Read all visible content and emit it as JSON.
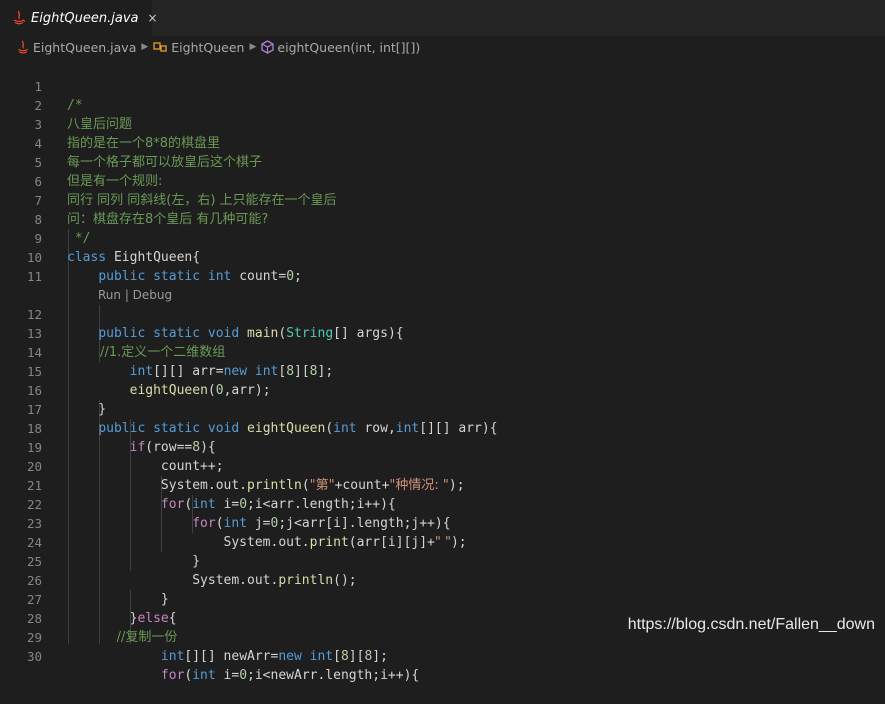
{
  "tab": {
    "title": "EightQueen.java",
    "close": "×"
  },
  "breadcrumb": {
    "file": "EightQueen.java",
    "class": "EightQueen",
    "method": "eightQueen(int, int[][])"
  },
  "codelens": "Run | Debug",
  "lines": [
    {
      "n": "1",
      "text": "/*"
    },
    {
      "n": "2",
      "text": "八皇后问题"
    },
    {
      "n": "3",
      "text": "指的是在一个8*8的棋盘里"
    },
    {
      "n": "4",
      "text": "每一个格子都可以放皇后这个棋子"
    },
    {
      "n": "5",
      "text": "但是有一个规则:"
    },
    {
      "n": "6",
      "text": "同行 同列 同斜线(左，右) 上只能存在一个皇后"
    },
    {
      "n": "7",
      "text": "问：棋盘存在8个皇后 有几种可能?"
    },
    {
      "n": "8",
      "text": " */"
    },
    {
      "n": "9",
      "text": "class EightQueen{"
    },
    {
      "n": "10",
      "text": "    public static int count=0;"
    },
    {
      "n": "11",
      "text": ""
    },
    {
      "n": "12",
      "text": "    public static void main(String[] args){"
    },
    {
      "n": "13",
      "text": "        //1.定义一个二维数组"
    },
    {
      "n": "14",
      "text": "        int[][] arr=new int[8][8];"
    },
    {
      "n": "15",
      "text": "        eightQueen(0,arr);"
    },
    {
      "n": "16",
      "text": "    }"
    },
    {
      "n": "17",
      "text": "    public static void eightQueen(int row,int[][] arr){"
    },
    {
      "n": "18",
      "text": "        if(row==8){"
    },
    {
      "n": "19",
      "text": "            count++;"
    },
    {
      "n": "20",
      "text": "            System.out.println(\"第\"+count+\"种情况: \");"
    },
    {
      "n": "21",
      "text": "            for(int i=0;i<arr.length;i++){"
    },
    {
      "n": "22",
      "text": "                for(int j=0;j<arr[i].length;j++){"
    },
    {
      "n": "23",
      "text": "                    System.out.print(arr[i][j]+\" \");"
    },
    {
      "n": "24",
      "text": "                }"
    },
    {
      "n": "25",
      "text": "                System.out.println();"
    },
    {
      "n": "26",
      "text": "            }"
    },
    {
      "n": "27",
      "text": "        }else{"
    },
    {
      "n": "28",
      "text": "            //复制一份"
    },
    {
      "n": "29",
      "text": "            int[][] newArr=new int[8][8];"
    },
    {
      "n": "30",
      "text": "            for(int i=0;i<newArr.length;i++){"
    }
  ],
  "watermark": "https://blog.csdn.net/Fallen__down",
  "colors": {
    "background": "#1e1e1e",
    "comment": "#6a9955",
    "keyword": "#569cd6",
    "string": "#ce9178",
    "number": "#b5cea8",
    "function": "#dcdcaa",
    "type": "#4ec9b0",
    "control": "#c586c0"
  },
  "icons": [
    "java-file-icon",
    "close-icon",
    "class-icon",
    "method-icon",
    "chevron-right-icon"
  ]
}
